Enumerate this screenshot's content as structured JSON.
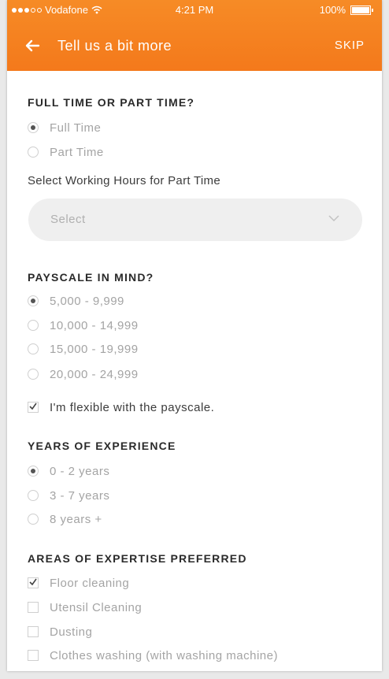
{
  "status_bar": {
    "carrier": "Vodafone",
    "time": "4:21 PM",
    "battery": "100%"
  },
  "nav": {
    "title": "Tell us a bit more",
    "skip": "SKIP"
  },
  "work_type": {
    "heading": "FULL TIME OR PART TIME?",
    "options": [
      {
        "label": "Full Time",
        "selected": true
      },
      {
        "label": "Part Time",
        "selected": false
      }
    ],
    "hours_label": "Select Working Hours for Part Time",
    "hours_select": "Select"
  },
  "payscale": {
    "heading": "PAYSCALE IN MIND?",
    "options": [
      {
        "label": "5,000 - 9,999",
        "selected": true
      },
      {
        "label": "10,000 - 14,999",
        "selected": false
      },
      {
        "label": "15,000 - 19,999",
        "selected": false
      },
      {
        "label": "20,000 - 24,999",
        "selected": false
      }
    ],
    "flexible": {
      "label": "I'm flexible with the payscale.",
      "checked": true
    }
  },
  "experience": {
    "heading": "YEARS OF EXPERIENCE",
    "options": [
      {
        "label": "0 - 2 years",
        "selected": true
      },
      {
        "label": "3 - 7 years",
        "selected": false
      },
      {
        "label": "8 years +",
        "selected": false
      }
    ]
  },
  "expertise": {
    "heading": "AREAS OF EXPERTISE PREFERRED",
    "options": [
      {
        "label": "Floor cleaning",
        "checked": true
      },
      {
        "label": "Utensil Cleaning",
        "checked": false
      },
      {
        "label": "Dusting",
        "checked": false
      },
      {
        "label": "Clothes washing (with washing machine)",
        "checked": false
      }
    ]
  },
  "colors": {
    "header": "#f4791b",
    "text_dark": "#2a2a2a",
    "text_muted": "#a4a4a4"
  },
  "icons": {
    "back": "arrow-left",
    "dropdown": "chevron-down",
    "wifi": "wifi"
  }
}
